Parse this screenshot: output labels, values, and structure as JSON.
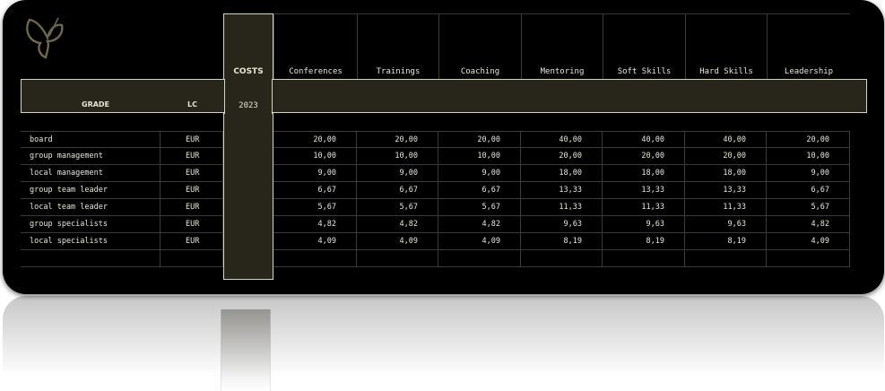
{
  "table": {
    "costs_title": "COSTS",
    "year": "2023",
    "grade_header": "GRADE",
    "lc_header": "LC",
    "columns": [
      "Conferences",
      "Trainings",
      "Coaching",
      "Mentoring",
      "Soft Skills",
      "Hard Skills",
      "Leadership"
    ],
    "rows": [
      {
        "grade": "board",
        "lc": "EUR",
        "values": [
          "20,00",
          "20,00",
          "20,00",
          "40,00",
          "40,00",
          "40,00",
          "20,00"
        ]
      },
      {
        "grade": "group management",
        "lc": "EUR",
        "values": [
          "10,00",
          "10,00",
          "10,00",
          "20,00",
          "20,00",
          "20,00",
          "10,00"
        ]
      },
      {
        "grade": "local management",
        "lc": "EUR",
        "values": [
          "9,00",
          "9,00",
          "9,00",
          "18,00",
          "18,00",
          "18,00",
          "9,00"
        ]
      },
      {
        "grade": "group team leader",
        "lc": "EUR",
        "values": [
          "6,67",
          "6,67",
          "6,67",
          "13,33",
          "13,33",
          "13,33",
          "6,67"
        ]
      },
      {
        "grade": "local team leader",
        "lc": "EUR",
        "values": [
          "5,67",
          "5,67",
          "5,67",
          "11,33",
          "11,33",
          "11,33",
          "5,67"
        ]
      },
      {
        "grade": "group specialists",
        "lc": "EUR",
        "values": [
          "4,82",
          "4,82",
          "4,82",
          "9,63",
          "9,63",
          "9,63",
          "4,82"
        ]
      },
      {
        "grade": "local specialists",
        "lc": "EUR",
        "values": [
          "4,09",
          "4,09",
          "4,09",
          "8,19",
          "8,19",
          "8,19",
          "4,09"
        ]
      },
      {
        "grade": "",
        "lc": "",
        "values": [
          "",
          "",
          "",
          "",
          "",
          "",
          ""
        ]
      }
    ]
  },
  "colors": {
    "background": "#000000",
    "accent": "#28251b",
    "text": "#e8e4d4",
    "grid": "#3a3a3a"
  }
}
